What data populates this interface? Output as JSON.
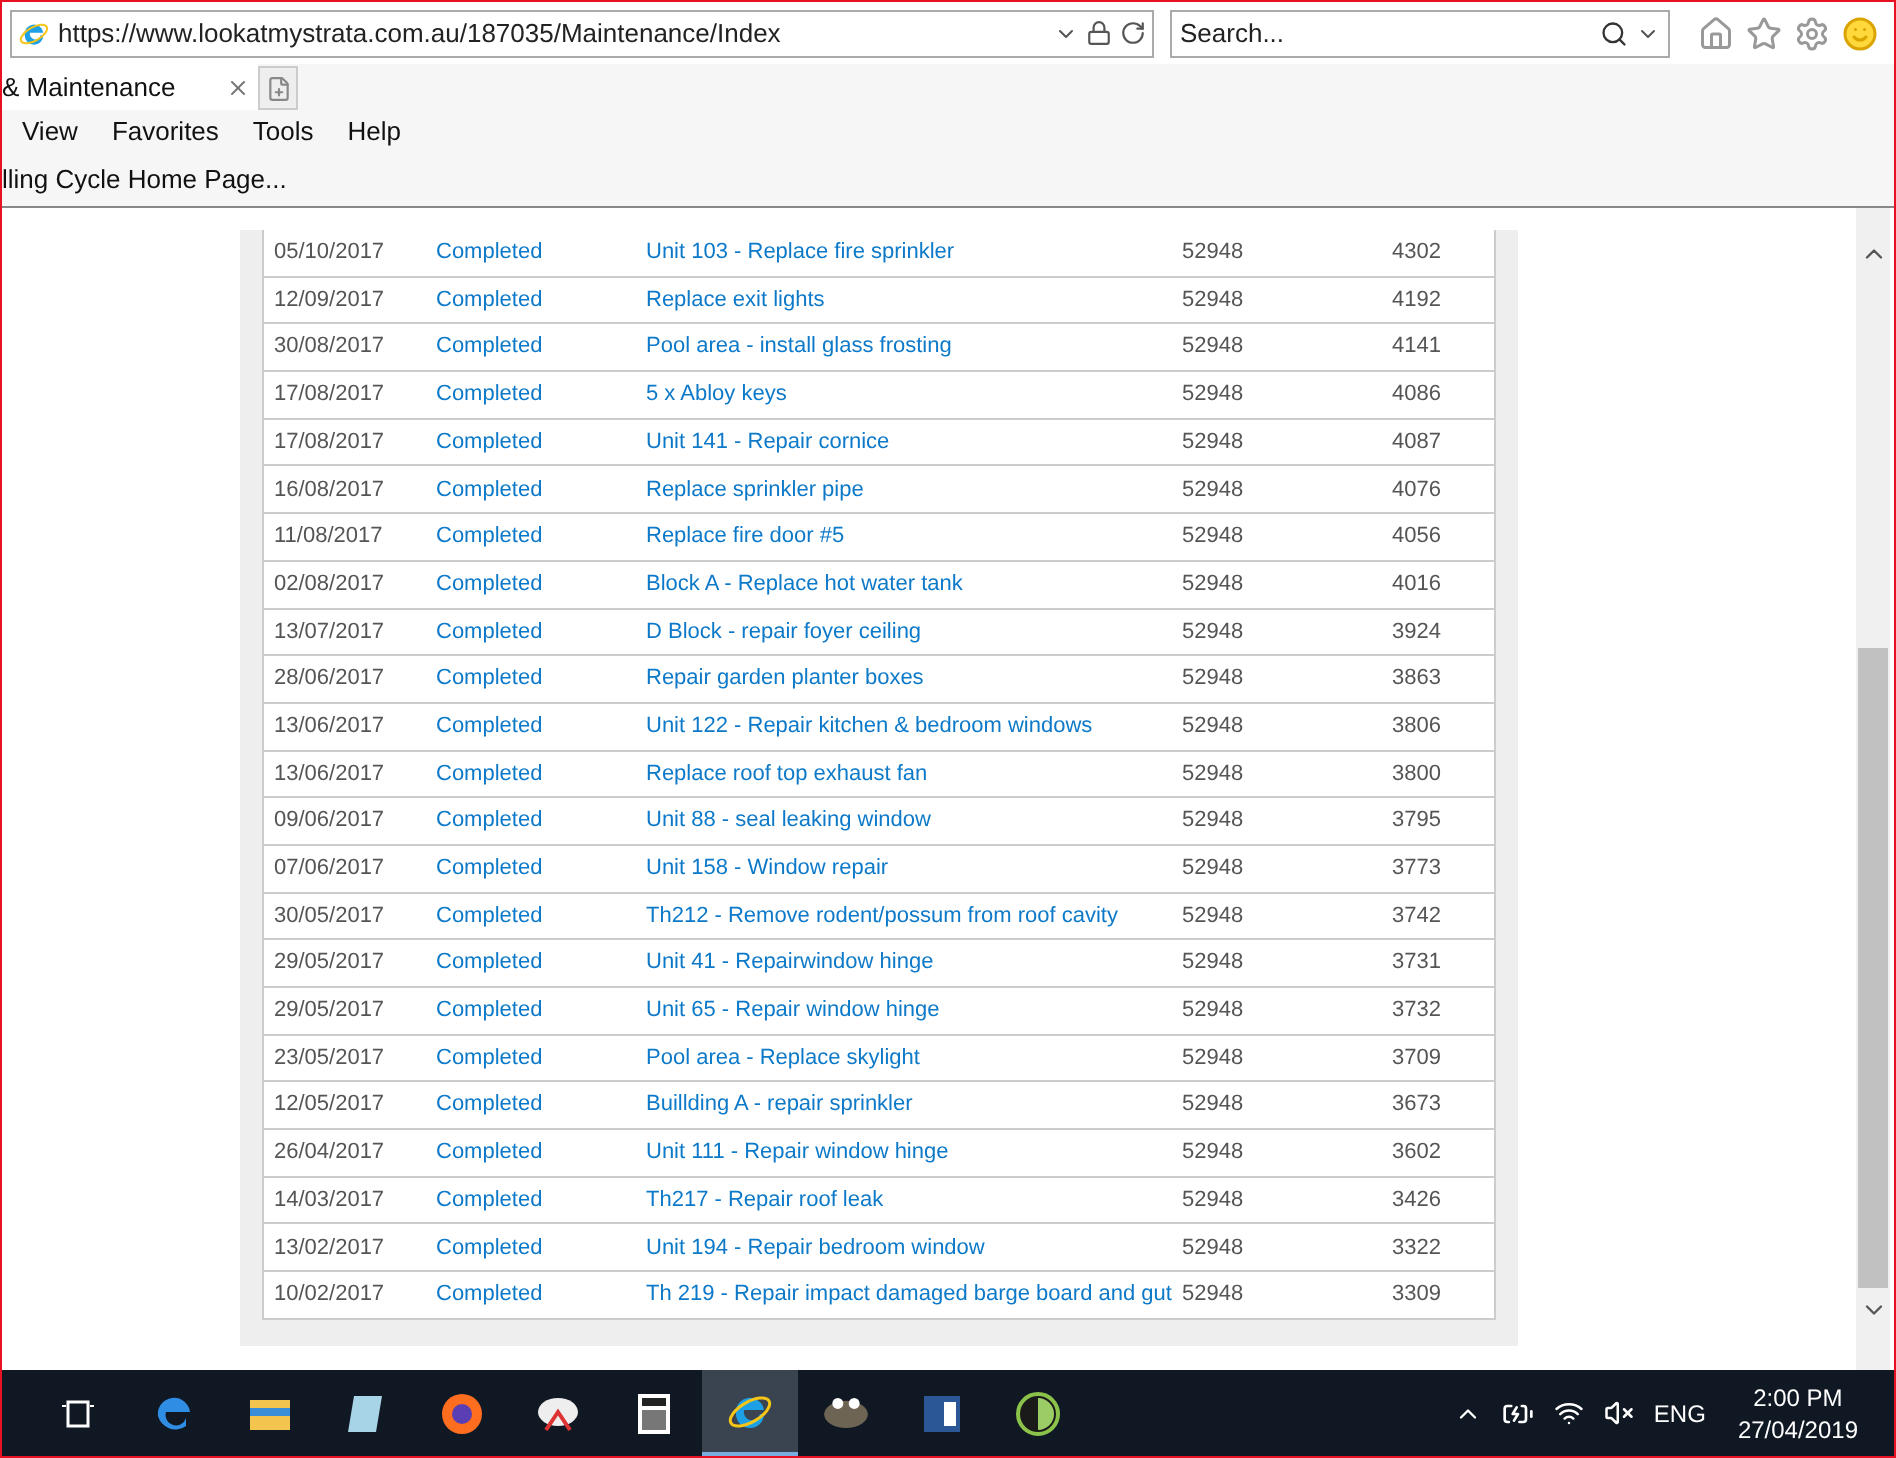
{
  "browser": {
    "address": "https://www.lookatmystrata.com.au/187035/Maintenance/Index",
    "search_placeholder": "Search...",
    "tab_title": "& Maintenance",
    "menu": [
      "View",
      "Favorites",
      "Tools",
      "Help"
    ],
    "favorites": [
      "lling Cycle Home Page..."
    ]
  },
  "table": {
    "rows": [
      {
        "date": "05/10/2017",
        "status": "Completed",
        "description": "Unit 103 - Replace fire sprinkler",
        "number": "52948",
        "id": "4302"
      },
      {
        "date": "12/09/2017",
        "status": "Completed",
        "description": "Replace exit lights",
        "number": "52948",
        "id": "4192"
      },
      {
        "date": "30/08/2017",
        "status": "Completed",
        "description": "Pool area - install glass frosting",
        "number": "52948",
        "id": "4141"
      },
      {
        "date": "17/08/2017",
        "status": "Completed",
        "description": "5 x Abloy keys",
        "number": "52948",
        "id": "4086"
      },
      {
        "date": "17/08/2017",
        "status": "Completed",
        "description": "Unit 141 - Repair cornice",
        "number": "52948",
        "id": "4087"
      },
      {
        "date": "16/08/2017",
        "status": "Completed",
        "description": "Replace sprinkler pipe",
        "number": "52948",
        "id": "4076"
      },
      {
        "date": "11/08/2017",
        "status": "Completed",
        "description": "Replace fire door #5",
        "number": "52948",
        "id": "4056"
      },
      {
        "date": "02/08/2017",
        "status": "Completed",
        "description": "Block A - Replace hot water tank",
        "number": "52948",
        "id": "4016"
      },
      {
        "date": "13/07/2017",
        "status": "Completed",
        "description": "D Block - repair foyer ceiling",
        "number": "52948",
        "id": "3924"
      },
      {
        "date": "28/06/2017",
        "status": "Completed",
        "description": "Repair garden planter boxes",
        "number": "52948",
        "id": "3863"
      },
      {
        "date": "13/06/2017",
        "status": "Completed",
        "description": "Unit 122 - Repair kitchen & bedroom windows",
        "number": "52948",
        "id": "3806"
      },
      {
        "date": "13/06/2017",
        "status": "Completed",
        "description": "Replace roof top exhaust fan",
        "number": "52948",
        "id": "3800"
      },
      {
        "date": "09/06/2017",
        "status": "Completed",
        "description": "Unit 88 - seal leaking window",
        "number": "52948",
        "id": "3795"
      },
      {
        "date": "07/06/2017",
        "status": "Completed",
        "description": "Unit 158 - Window repair",
        "number": "52948",
        "id": "3773"
      },
      {
        "date": "30/05/2017",
        "status": "Completed",
        "description": "Th212 - Remove rodent/possum from roof cavity",
        "number": "52948",
        "id": "3742"
      },
      {
        "date": "29/05/2017",
        "status": "Completed",
        "description": "Unit 41 - Repairwindow hinge",
        "number": "52948",
        "id": "3731"
      },
      {
        "date": "29/05/2017",
        "status": "Completed",
        "description": "Unit 65 - Repair window hinge",
        "number": "52948",
        "id": "3732"
      },
      {
        "date": "23/05/2017",
        "status": "Completed",
        "description": "Pool area - Replace skylight",
        "number": "52948",
        "id": "3709"
      },
      {
        "date": "12/05/2017",
        "status": "Completed",
        "description": "Buillding A - repair sprinkler",
        "number": "52948",
        "id": "3673"
      },
      {
        "date": "26/04/2017",
        "status": "Completed",
        "description": "Unit 111 - Repair window hinge",
        "number": "52948",
        "id": "3602"
      },
      {
        "date": "14/03/2017",
        "status": "Completed",
        "description": "Th217 - Repair roof leak",
        "number": "52948",
        "id": "3426"
      },
      {
        "date": "13/02/2017",
        "status": "Completed",
        "description": "Unit 194 - Repair bedroom window",
        "number": "52948",
        "id": "3322"
      },
      {
        "date": "10/02/2017",
        "status": "Completed",
        "description": "Th 219 - Repair impact damaged barge board and gut",
        "number": "52948",
        "id": "3309"
      }
    ]
  },
  "taskbar": {
    "apps": [
      {
        "kind": "task-view",
        "selected": false
      },
      {
        "kind": "edge",
        "selected": false
      },
      {
        "kind": "folder",
        "selected": false
      },
      {
        "kind": "notepad",
        "selected": false
      },
      {
        "kind": "firefox",
        "selected": false
      },
      {
        "kind": "snip",
        "selected": false
      },
      {
        "kind": "calculator",
        "selected": false
      },
      {
        "kind": "ie",
        "selected": true
      },
      {
        "kind": "gimp",
        "selected": false
      },
      {
        "kind": "word",
        "selected": false
      },
      {
        "kind": "disc",
        "selected": false
      }
    ],
    "language": "ENG",
    "time": "2:00 PM",
    "date": "27/04/2019"
  }
}
